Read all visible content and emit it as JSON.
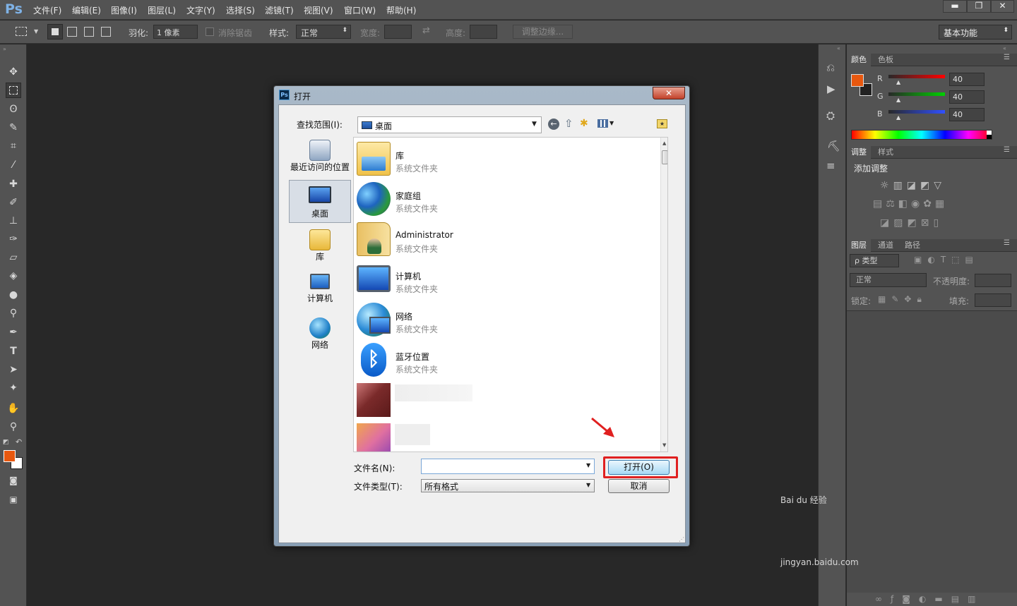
{
  "app": {
    "logo": "Ps"
  },
  "menu": [
    "文件(F)",
    "编辑(E)",
    "图像(I)",
    "图层(L)",
    "文字(Y)",
    "选择(S)",
    "滤镜(T)",
    "视图(V)",
    "窗口(W)",
    "帮助(H)"
  ],
  "window_buttons": [
    "▬",
    "❐",
    "✕"
  ],
  "options": {
    "feather_label": "羽化:",
    "feather_value": "1 像素",
    "antialias_label": "消除锯齿",
    "style_label": "样式:",
    "style_value": "正常",
    "width_label": "宽度:",
    "height_label": "高度:",
    "refine_label": "调整边缘...",
    "workspace": "基本功能"
  },
  "color_panel": {
    "tabs": [
      "颜色",
      "色板"
    ],
    "foreground": "#e8580f",
    "channels": [
      {
        "label": "R",
        "value": "40"
      },
      {
        "label": "G",
        "value": "40"
      },
      {
        "label": "B",
        "value": "40"
      }
    ]
  },
  "adjust_panel": {
    "tabs": [
      "调整",
      "样式"
    ],
    "title": "添加调整"
  },
  "layers_panel": {
    "tabs": [
      "图层",
      "通道",
      "路径"
    ],
    "filter": "ρ 类型",
    "blend": "正常",
    "opacity_label": "不透明度:",
    "lock_label": "锁定:",
    "fill_label": "填充:"
  },
  "dialog": {
    "title": "打开",
    "close": "✕",
    "lookin_label": "查找范围(I):",
    "lookin_value": "桌面",
    "places": [
      {
        "label": "最近访问的位置",
        "icon": "recent-places-icon"
      },
      {
        "label": "桌面",
        "icon": "desktop-icon"
      },
      {
        "label": "库",
        "icon": "library-icon"
      },
      {
        "label": "计算机",
        "icon": "computer-icon"
      },
      {
        "label": "网络",
        "icon": "network-icon"
      }
    ],
    "files": [
      {
        "name": "库",
        "type": "系统文件夹",
        "icon": "library-folder-icon"
      },
      {
        "name": "家庭组",
        "type": "系统文件夹",
        "icon": "homegroup-icon"
      },
      {
        "name": "Administrator",
        "type": "系统文件夹",
        "icon": "user-folder-icon"
      },
      {
        "name": "计算机",
        "type": "系统文件夹",
        "icon": "computer-icon"
      },
      {
        "name": "网络",
        "type": "系统文件夹",
        "icon": "network-icon"
      },
      {
        "name": "蓝牙位置",
        "type": "系统文件夹",
        "icon": "bluetooth-icon"
      }
    ],
    "filename_label": "文件名(N):",
    "filename_value": "",
    "filetype_label": "文件类型(T):",
    "filetype_value": "所有格式",
    "open_button": "打开(O)",
    "cancel_button": "取消"
  },
  "watermark": {
    "brand": "Bai du 经验",
    "url": "jingyan.baidu.com"
  }
}
